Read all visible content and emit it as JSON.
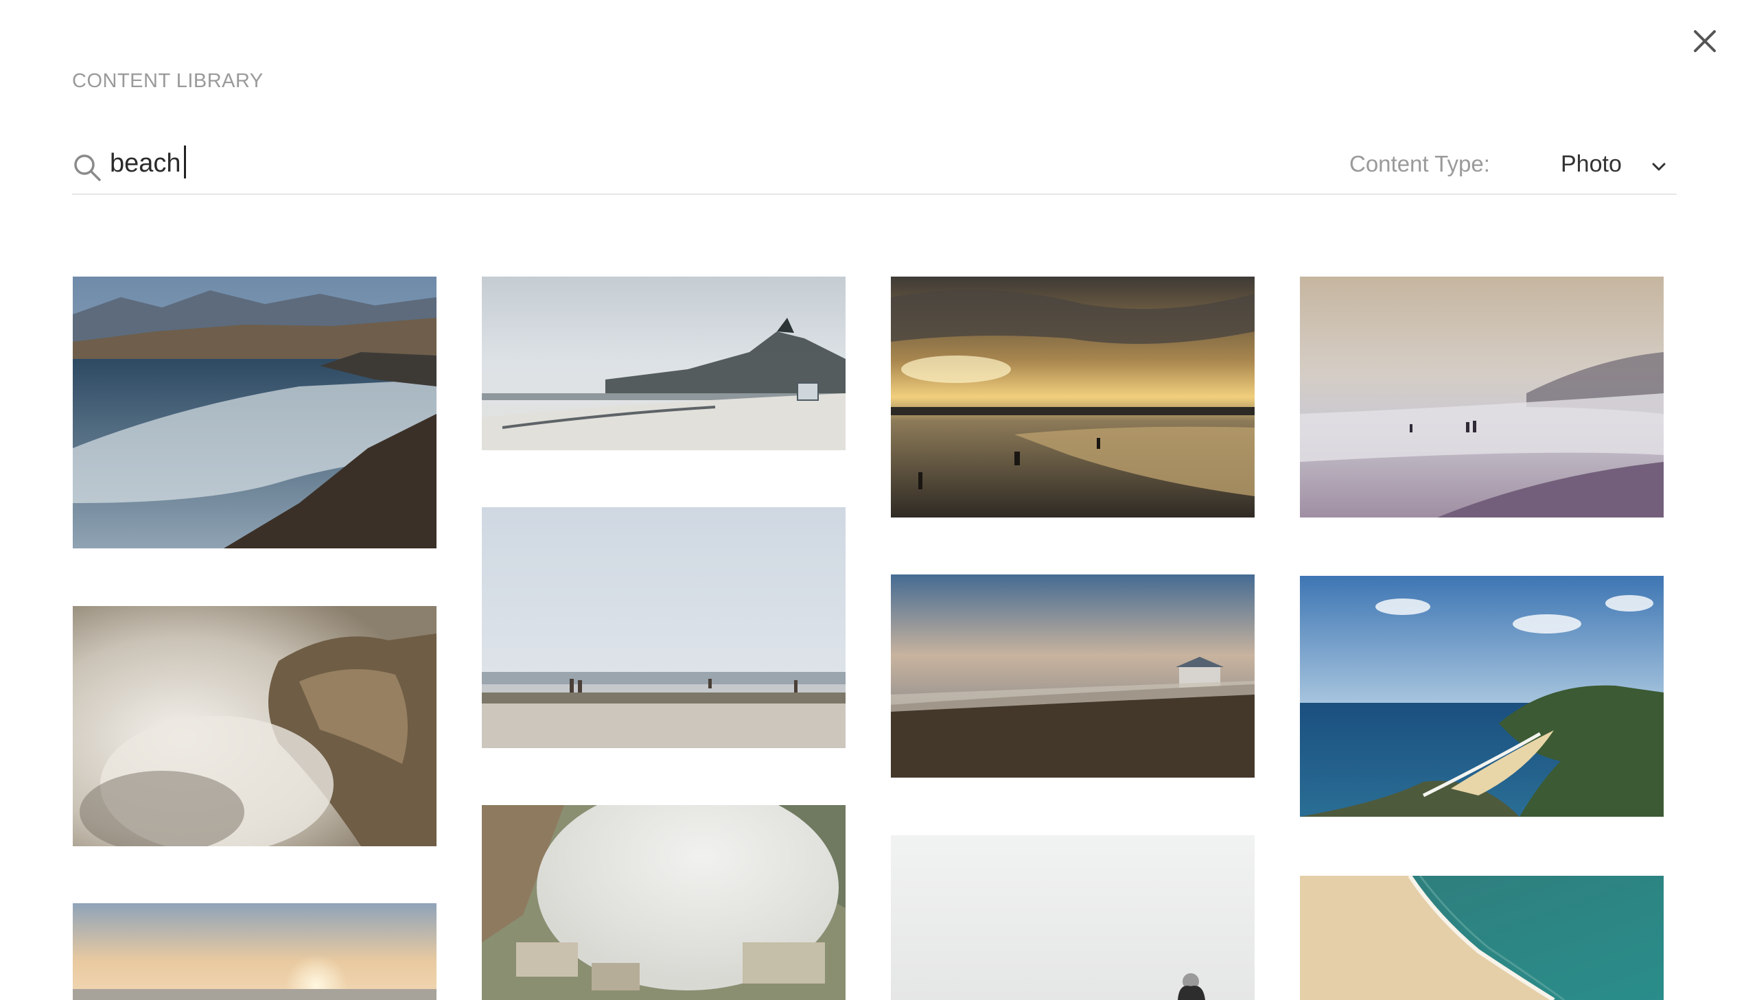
{
  "header": {
    "title": "CONTENT LIBRARY"
  },
  "search": {
    "value": "beach"
  },
  "filter": {
    "label": "Content Type:",
    "selected": "Photo"
  },
  "icons": {
    "close": "close-icon",
    "search": "search-icon",
    "dropdown": "chevron-down-icon"
  },
  "results": [
    {
      "subject": "rocky coastline with waves"
    },
    {
      "subject": "foggy beach with lifeguard tower"
    },
    {
      "subject": "sunset beach with silhouettes"
    },
    {
      "subject": "misty beach at dusk"
    },
    {
      "subject": "waves crashing on rocks"
    },
    {
      "subject": "calm beach with walkers"
    },
    {
      "subject": "beach at sunset with houses"
    },
    {
      "subject": "green headland and blue sea"
    },
    {
      "subject": "sunrise over the sea"
    },
    {
      "subject": "fog over coastal town"
    },
    {
      "subject": "person on a white beach"
    },
    {
      "subject": "aerial sandy shore and turquoise water"
    }
  ]
}
